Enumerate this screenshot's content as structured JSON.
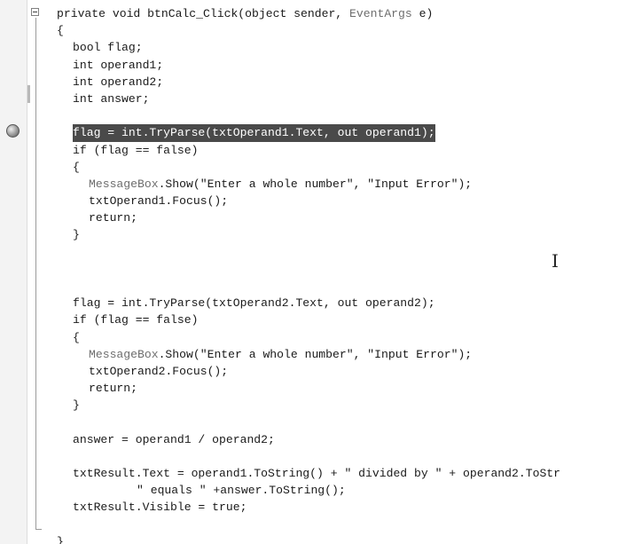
{
  "editor": {
    "lines": [
      {
        "indent": 0,
        "text": "private void btnCalc_Click(object sender, EventArgs e)"
      },
      {
        "indent": 0,
        "text": "{"
      },
      {
        "indent": 1,
        "text": "bool flag;"
      },
      {
        "indent": 1,
        "text": "int operand1;"
      },
      {
        "indent": 1,
        "text": "int operand2;"
      },
      {
        "indent": 1,
        "text": "int answer;"
      },
      {
        "indent": 0,
        "text": ""
      },
      {
        "indent": 1,
        "text": "flag = int.TryParse(txtOperand1.Text, out operand1);",
        "highlighted": true
      },
      {
        "indent": 1,
        "text": "if (flag == false)"
      },
      {
        "indent": 1,
        "text": "{"
      },
      {
        "indent": 2,
        "text": "MessageBox.Show(\"Enter a whole number\", \"Input Error\");"
      },
      {
        "indent": 2,
        "text": "txtOperand1.Focus();"
      },
      {
        "indent": 2,
        "text": "return;"
      },
      {
        "indent": 1,
        "text": "}"
      },
      {
        "indent": 0,
        "text": ""
      },
      {
        "indent": 0,
        "text": ""
      },
      {
        "indent": 0,
        "text": ""
      },
      {
        "indent": 1,
        "text": "flag = int.TryParse(txtOperand2.Text, out operand2);"
      },
      {
        "indent": 1,
        "text": "if (flag == false)"
      },
      {
        "indent": 1,
        "text": "{"
      },
      {
        "indent": 2,
        "text": "MessageBox.Show(\"Enter a whole number\", \"Input Error\");"
      },
      {
        "indent": 2,
        "text": "txtOperand2.Focus();"
      },
      {
        "indent": 2,
        "text": "return;"
      },
      {
        "indent": 1,
        "text": "}"
      },
      {
        "indent": 0,
        "text": ""
      },
      {
        "indent": 1,
        "text": "answer = operand1 / operand2;"
      },
      {
        "indent": 0,
        "text": ""
      },
      {
        "indent": 1,
        "text": "txtResult.Text = operand1.ToString() + \" divided by \" + operand2.ToStr"
      },
      {
        "indent": 5,
        "text": "\" equals \" +answer.ToString();"
      },
      {
        "indent": 1,
        "text": "txtResult.Visible = true;"
      },
      {
        "indent": 0,
        "text": ""
      },
      {
        "indent": 0,
        "text": "}"
      }
    ],
    "type_names": [
      "EventArgs",
      "MessageBox"
    ]
  }
}
